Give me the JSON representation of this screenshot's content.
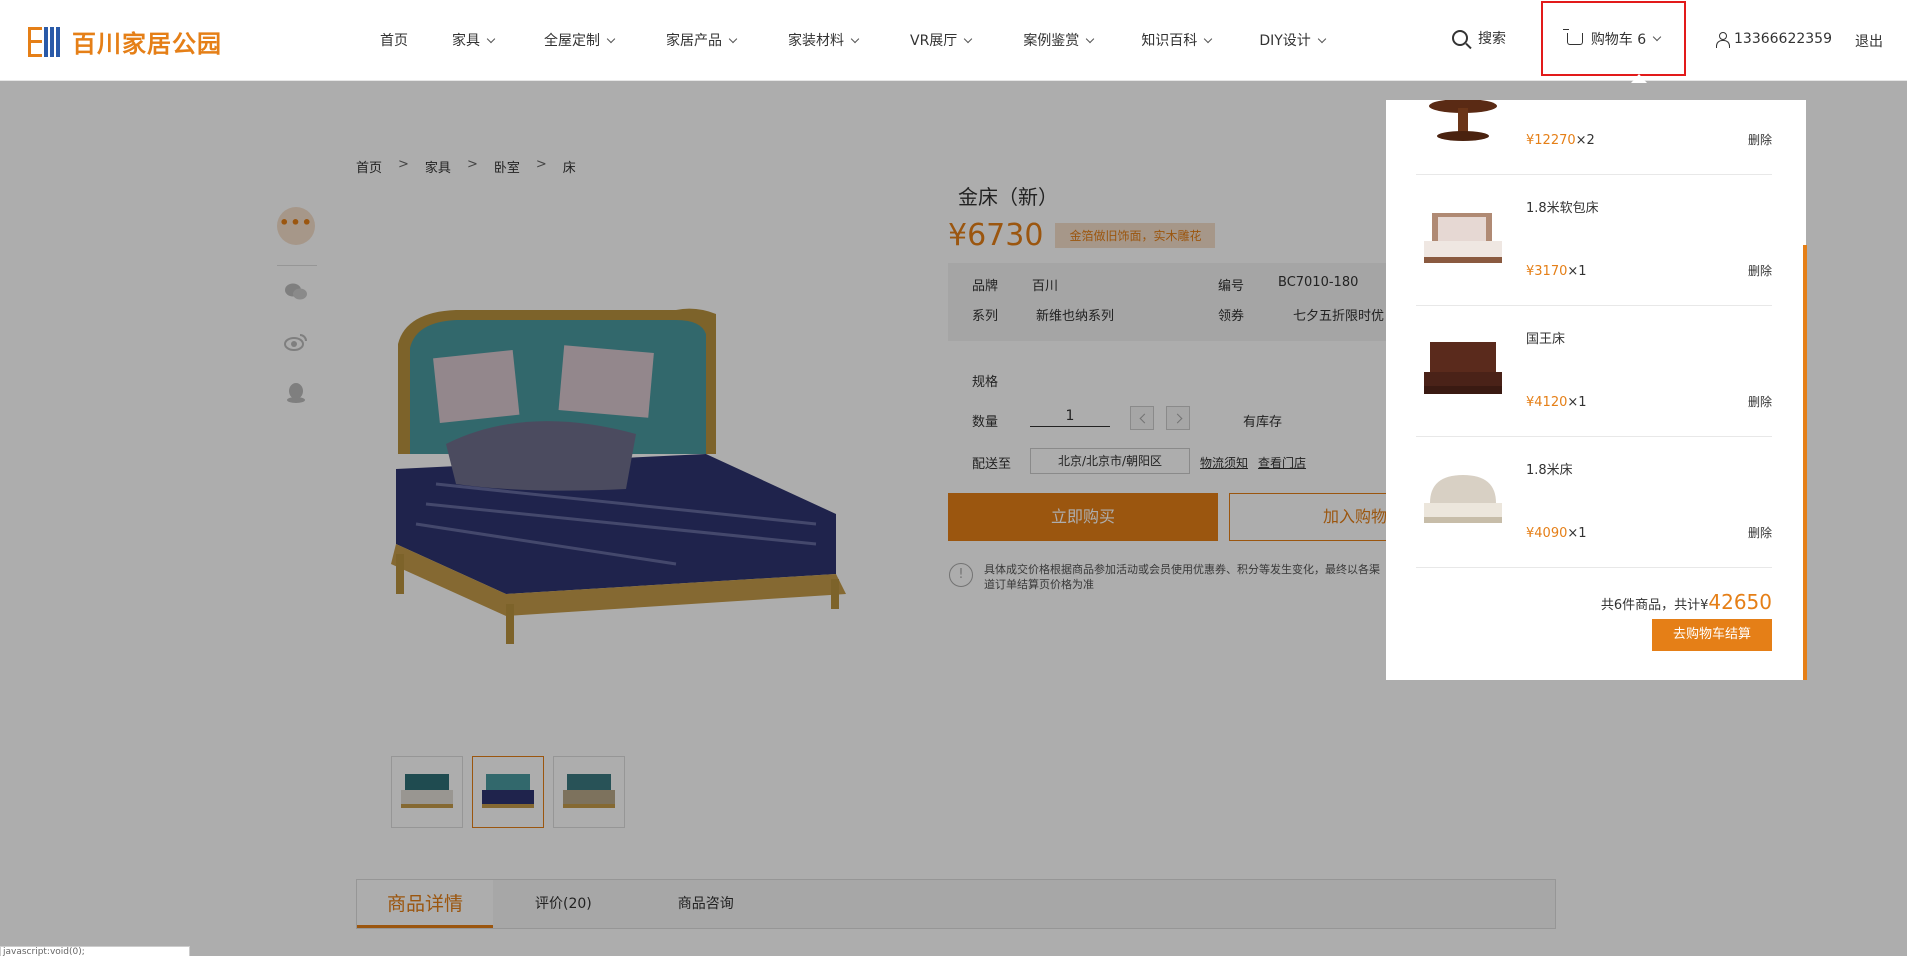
{
  "header": {
    "logo_text": "百川家居公园",
    "nav": [
      {
        "label": "首页",
        "has_menu": false
      },
      {
        "label": "家具",
        "has_menu": true
      },
      {
        "label": "全屋定制",
        "has_menu": true
      },
      {
        "label": "家居产品",
        "has_menu": true
      },
      {
        "label": "家装材料",
        "has_menu": true
      },
      {
        "label": "VR展厅",
        "has_menu": true
      },
      {
        "label": "案例鉴赏",
        "has_menu": true
      },
      {
        "label": "知识百科",
        "has_menu": true
      },
      {
        "label": "DIY设计",
        "has_menu": true
      }
    ],
    "search_label": "搜索",
    "cart_label": "购物车 6",
    "user_phone": "13366622359",
    "logout_label": "退出"
  },
  "breadcrumb": [
    "首页",
    "家具",
    "卧室",
    "床"
  ],
  "breadcrumb_sep": ">",
  "share": {
    "more": "•••"
  },
  "product": {
    "title": "金床（新）",
    "price": "¥6730",
    "promo": "金箔做旧饰面，实木雕花",
    "specs": {
      "brand_label": "品牌",
      "brand": "百川",
      "code_label": "编号",
      "code": "BC7010-180",
      "series_label": "系列",
      "series": "新维也纳系列",
      "coupon_label": "领券",
      "coupon": "七夕五折限时优"
    },
    "spec_label": "规格",
    "qty_label": "数量",
    "qty_value": "1",
    "stock": "有库存",
    "ship_label": "配送至",
    "ship_address": "北京/北京市/朝阳区",
    "logistics_link": "物流须知",
    "store_link": "查看门店",
    "buy_now": "立即购买",
    "add_cart": "加入购物车",
    "notice_icon": "!",
    "notice": "具体成交价格根据商品参加活动或会员使用优惠券、积分等发生变化，最终以各渠道订单结算页价格为准"
  },
  "tabs": [
    "商品详情",
    "评价(20)",
    "商品咨询"
  ],
  "status_text": "javascript:void(0);",
  "cart_dropdown": {
    "items": [
      {
        "name": "",
        "price": "¥12270",
        "qty": "×2",
        "delete": "删除"
      },
      {
        "name": "1.8米软包床",
        "price": "¥3170",
        "qty": "×1",
        "delete": "删除"
      },
      {
        "name": "国王床",
        "price": "¥4120",
        "qty": "×1",
        "delete": "删除"
      },
      {
        "name": "1.8米床",
        "price": "¥4090",
        "qty": "×1",
        "delete": "删除"
      }
    ],
    "total_prefix": "共6件商品，共计¥",
    "total": "42650",
    "checkout": "去购物车结算"
  },
  "colors": {
    "accent": "#e57f17",
    "brand_blue": "#2a5aa8",
    "highlight": "#e21a1a"
  }
}
